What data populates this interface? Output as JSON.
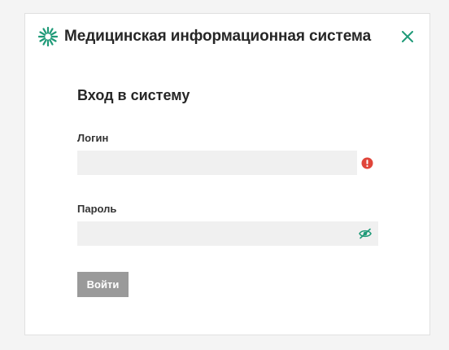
{
  "header": {
    "title": "Медицинская информационная система",
    "logo_icon": "sunburst-logo-icon",
    "close_icon": "close-icon"
  },
  "form": {
    "title": "Вход в систему",
    "login": {
      "label": "Логин",
      "value": "",
      "placeholder": "",
      "status_icon": "error-icon"
    },
    "password": {
      "label": "Пароль",
      "value": "",
      "placeholder": "",
      "toggle_icon": "eye-icon"
    },
    "submit_label": "Войти"
  },
  "colors": {
    "accent": "#1f9a78",
    "error": "#e0453a",
    "button_disabled": "#9a9a9a",
    "input_bg": "#f0f0f0",
    "page_bg": "#f4f4f4"
  }
}
